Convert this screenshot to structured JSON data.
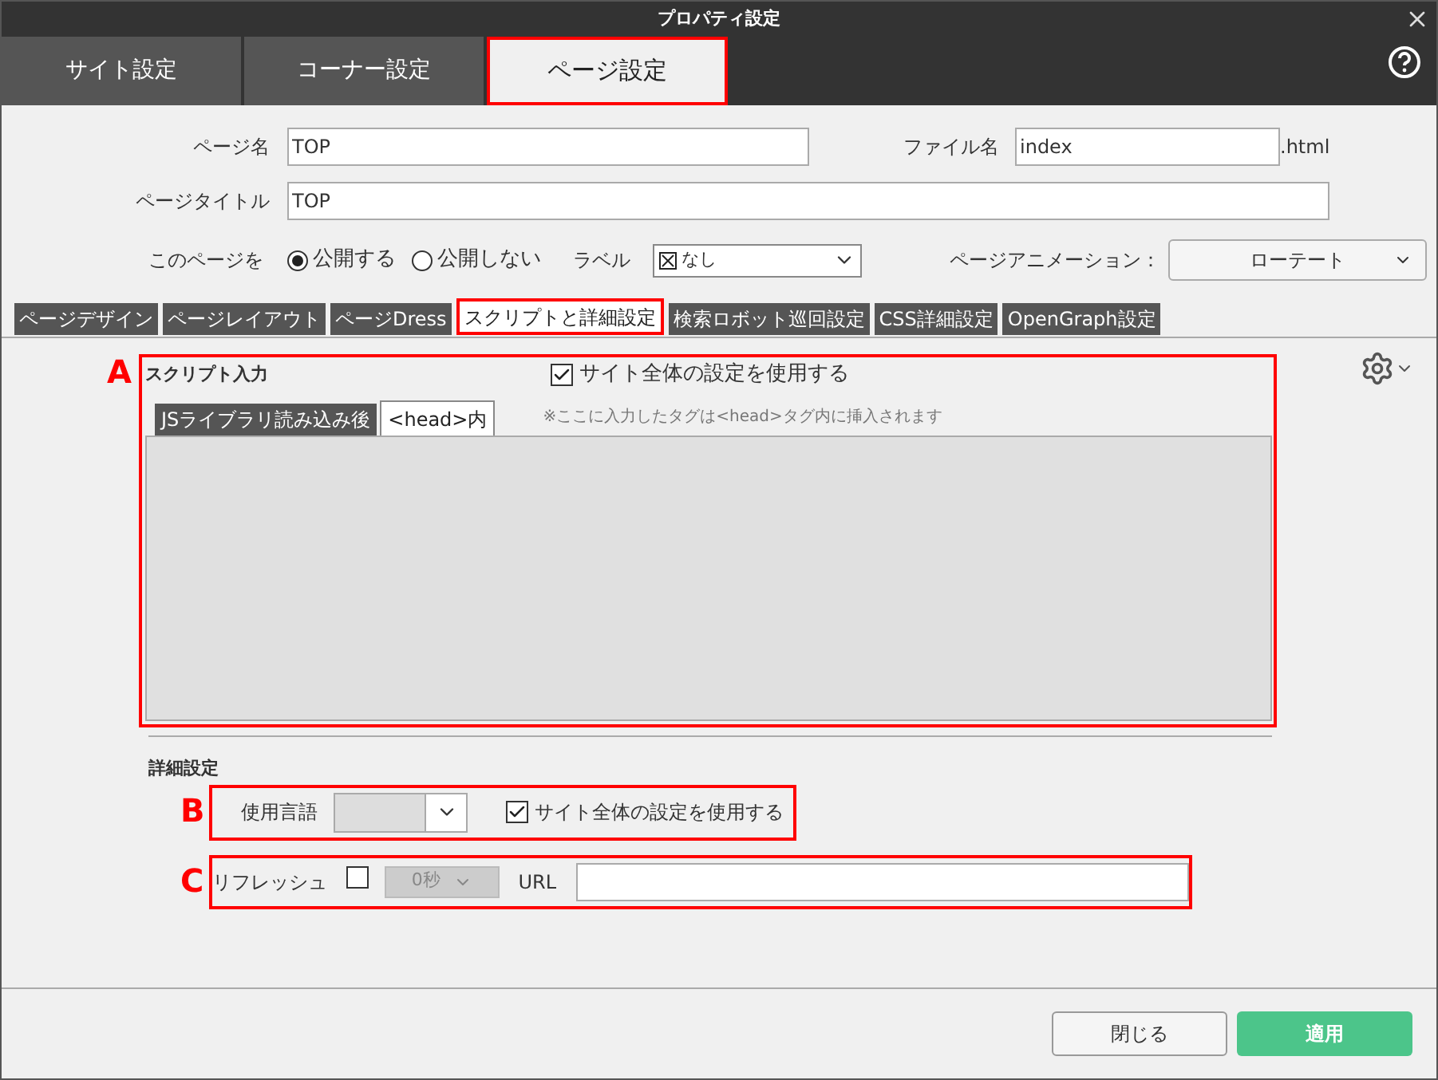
{
  "window": {
    "title": "プロパティ設定"
  },
  "main_tabs": [
    {
      "label": "サイト設定",
      "selected": false
    },
    {
      "label": "コーナー設定",
      "selected": false
    },
    {
      "label": "ページ設定",
      "selected": true
    }
  ],
  "page_name": {
    "label": "ページ名",
    "value": "TOP"
  },
  "file_name": {
    "label": "ファイル名",
    "value": "index",
    "suffix": ".html"
  },
  "page_title": {
    "label": "ページタイトル",
    "value": "TOP"
  },
  "publish": {
    "label": "このページを",
    "options": [
      {
        "label": "公開する",
        "selected": true
      },
      {
        "label": "公開しない",
        "selected": false
      }
    ]
  },
  "label_select": {
    "label": "ラベル",
    "value": "なし"
  },
  "animation": {
    "label": "ページアニメーション：",
    "value": "ローテート"
  },
  "sub_tabs": [
    {
      "label": "ページデザイン",
      "selected": false
    },
    {
      "label": "ページレイアウト",
      "selected": false
    },
    {
      "label": "ページDress",
      "selected": false
    },
    {
      "label": "スクリプトと詳細設定",
      "selected": true
    },
    {
      "label": "検索ロボット巡回設定",
      "selected": false
    },
    {
      "label": "CSS詳細設定",
      "selected": false
    },
    {
      "label": "OpenGraph設定",
      "selected": false
    }
  ],
  "script_section": {
    "annotation": "A",
    "title": "スクリプト入力",
    "use_site": {
      "label": "サイト全体の設定を使用する",
      "checked": true
    },
    "tabs": [
      {
        "label": "JSライブラリ読み込み後",
        "selected": false
      },
      {
        "label": "<head>内",
        "selected": true
      }
    ],
    "note": "※ここに入力したタグは<head>タグ内に挿入されます"
  },
  "detail_section": {
    "title": "詳細設定",
    "language": {
      "annotation": "B",
      "label": "使用言語",
      "use_site": {
        "label": "サイト全体の設定を使用する",
        "checked": true
      }
    },
    "refresh": {
      "annotation": "C",
      "label": "リフレッシュ",
      "checked": false,
      "interval": "0秒",
      "url_label": "URL"
    }
  },
  "buttons": [
    {
      "label": "閉じる",
      "kind": "secondary"
    },
    {
      "label": "適用",
      "kind": "primary"
    }
  ]
}
